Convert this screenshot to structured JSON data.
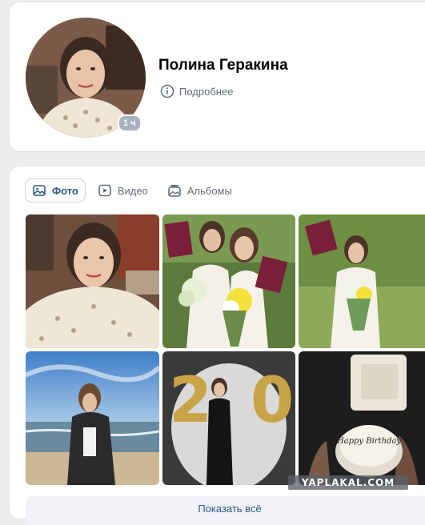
{
  "profile": {
    "name": "Полина Геракина",
    "online_badge": "1 ч",
    "details_label": "Подробнее"
  },
  "media": {
    "tabs": [
      {
        "label": "Фото",
        "icon": "photo-icon",
        "active": true
      },
      {
        "label": "Видео",
        "icon": "video-icon",
        "active": false
      },
      {
        "label": "Альбомы",
        "icon": "albums-icon",
        "active": false
      }
    ],
    "show_all_label": "Показать всё",
    "photos": [
      {
        "id": "selfie-photo",
        "icon": "photo"
      },
      {
        "id": "graduation-duo-photo",
        "icon": "photo"
      },
      {
        "id": "graduation-solo-photo",
        "icon": "photo"
      },
      {
        "id": "beach-photo",
        "icon": "photo"
      },
      {
        "id": "birthday-balloons-photo",
        "icon": "photo"
      },
      {
        "id": "birthday-cake-photo",
        "icon": "photo"
      }
    ],
    "cake_text": "Happy Birthday"
  },
  "watermark": "YAPLAKAL.COM",
  "colors": {
    "accent": "#2a5885",
    "page_bg": "#edeef0",
    "card_bg": "#ffffff",
    "muted": "#626d7a"
  }
}
